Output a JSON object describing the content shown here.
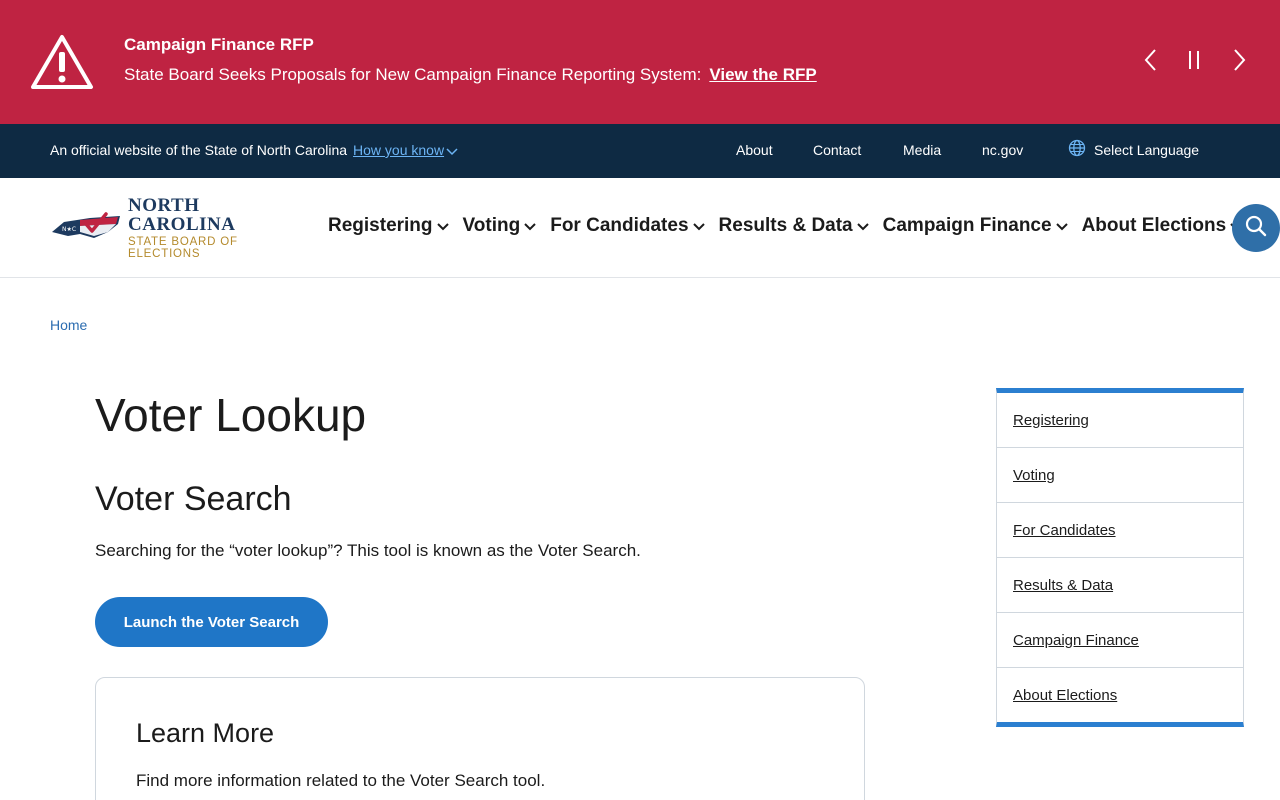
{
  "alert": {
    "title": "Campaign Finance RFP",
    "body": "State Board Seeks Proposals for New Campaign Finance Reporting System:",
    "link_label": "View the RFP",
    "icons": {
      "warning": "warning-triangle-icon",
      "prev": "chevron-left-icon",
      "pause": "pause-icon",
      "next": "chevron-right-icon"
    }
  },
  "utility": {
    "official_text": "An official website of the State of North Carolina",
    "how_know": "How you know",
    "links": [
      "About",
      "Contact",
      "Media",
      "nc.gov"
    ],
    "language": "Select Language"
  },
  "header": {
    "logo_line1": "NORTH CAROLINA",
    "logo_line2": "STATE BOARD OF ELECTIONS",
    "nav": [
      "Registering",
      "Voting",
      "For Candidates",
      "Results & Data",
      "Campaign Finance",
      "About Elections"
    ]
  },
  "breadcrumb": {
    "home": "Home"
  },
  "main": {
    "title": "Voter Lookup",
    "subtitle": "Voter Search",
    "intro": "Searching for the “voter lookup”? This tool is known as the Voter Search.",
    "launch_button": "Launch the Voter Search",
    "card": {
      "title": "Learn More",
      "text": "Find more information related to the Voter Search tool."
    }
  },
  "sidenav": [
    "Registering",
    "Voting",
    "For Candidates",
    "Results & Data",
    "Campaign Finance",
    "About Elections"
  ],
  "colors": {
    "alert": "#bf2342",
    "utility": "#0e2a43",
    "accent": "#1f76c7",
    "sidenav_border": "#2b7fd0"
  }
}
